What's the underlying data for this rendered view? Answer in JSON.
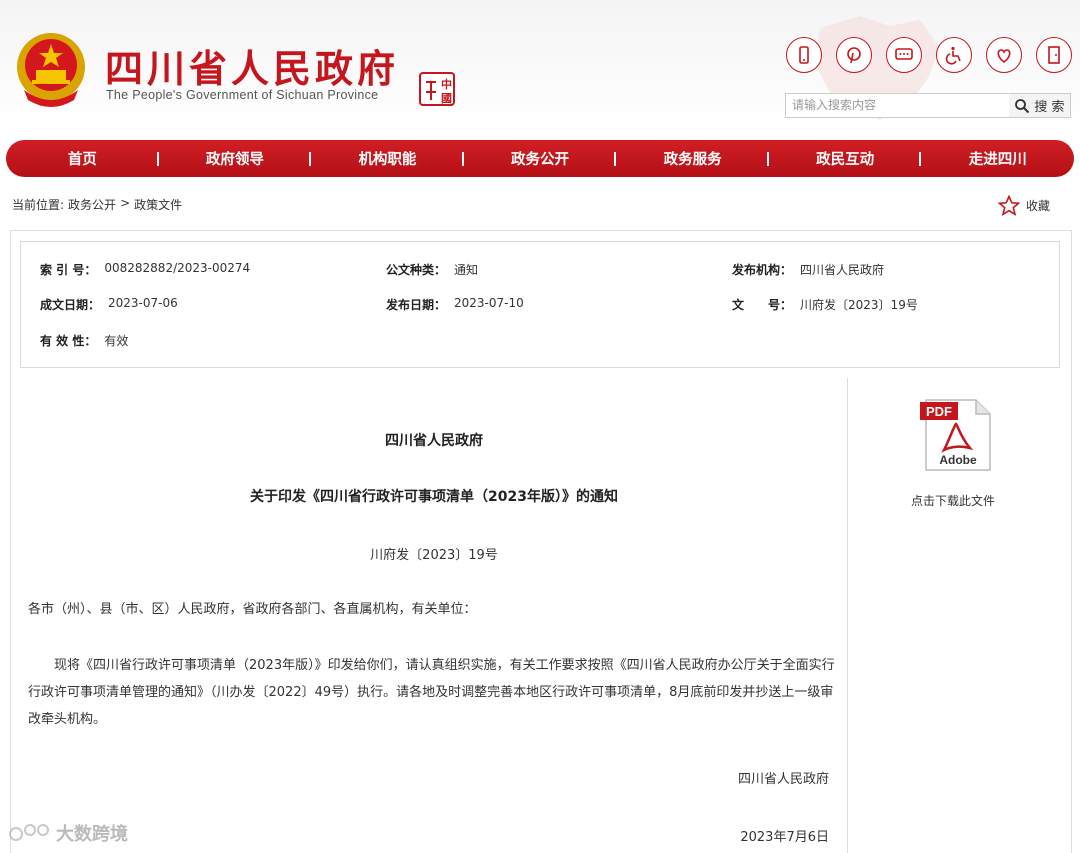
{
  "header": {
    "site_title": "四川省人民政府",
    "site_subtitle": "The People's Government of Sichuan Province",
    "seal_chars": [
      "中",
      "國"
    ]
  },
  "util_icons": [
    "mobile-icon",
    "pinterest-icon",
    "chat-icon",
    "accessibility-icon",
    "elderly-care-icon",
    "exit-icon"
  ],
  "search": {
    "placeholder": "请输入搜索内容",
    "button_label": "搜 索"
  },
  "nav": {
    "items": [
      "首页",
      "政府领导",
      "机构职能",
      "政务公开",
      "政务服务",
      "政民互动",
      "走进四川"
    ]
  },
  "breadcrumb": {
    "prefix": "当前位置:",
    "items": [
      "政务公开",
      "政策文件"
    ],
    "separator": ">"
  },
  "favorite": {
    "label": "收藏"
  },
  "meta": {
    "index_no_label": "索 引 号：",
    "index_no": "008282882/2023-00274",
    "doc_type_label": "公文种类：",
    "doc_type": "通知",
    "issuer_label": "发布机构：",
    "issuer": "四川省人民政府",
    "created_label": "成文日期：",
    "created": "2023-07-06",
    "published_label": "发布日期：",
    "published": "2023-07-10",
    "doc_no_label": "文　　号：",
    "doc_no": "川府发〔2023〕19号",
    "validity_label": "有 效 性：",
    "validity": "有效"
  },
  "document": {
    "org": "四川省人民政府",
    "title": "关于印发《四川省行政许可事项清单（2023年版）》的通知",
    "number": "川府发〔2023〕19号",
    "salutation": "各市（州）、县（市、区）人民政府，省政府各部门、各直属机构，有关单位：",
    "body": "现将《四川省行政许可事项清单（2023年版）》印发给你们，请认真组织实施，有关工作要求按照《四川省人民政府办公厅关于全面实行行政许可事项清单管理的通知》（川办发〔2022〕49号）执行。请各地及时调整完善本地区行政许可事项清单，8月底前印发并抄送上一级审改牵头机构。",
    "signature": "四川省人民政府",
    "date": "2023年7月6日"
  },
  "sidebar": {
    "download_label": "点击下载此文件",
    "pdf_badge": "PDF",
    "pdf_brand": "Adobe"
  },
  "watermark": {
    "text": "大数跨境"
  },
  "colors": {
    "brand_red": "#c4161c"
  }
}
